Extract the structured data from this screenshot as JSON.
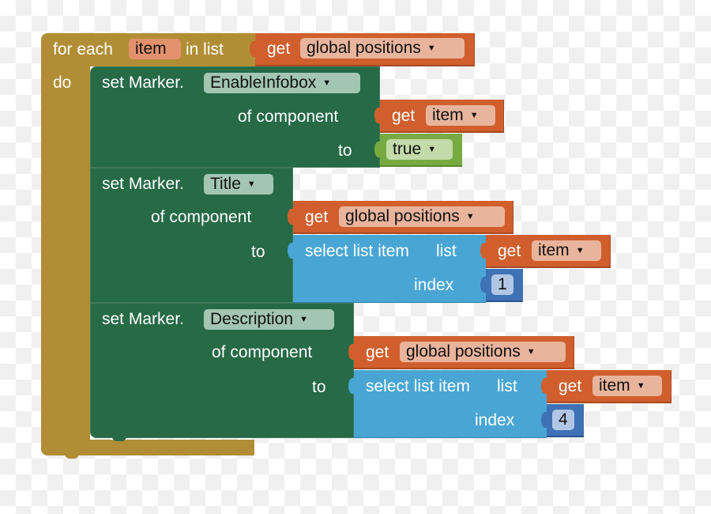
{
  "colors": {
    "control": "#b18e35",
    "component_setter": "#266a46",
    "variable_getter": "#d05f2d",
    "list": "#49a6d4",
    "math_number": "#3f71b5",
    "logic": "#77ab41",
    "checkerboard_light": "#ffffff",
    "checkerboard_dark": "#f0f0f0"
  },
  "for_each": {
    "label_for_each": "for each",
    "loop_var": "item",
    "label_in_list": "in list",
    "label_do": "do",
    "list_getter": {
      "label_get": "get",
      "var": "global positions"
    }
  },
  "setters": [
    {
      "label_set": "set Marker.",
      "property": "EnableInfobox",
      "label_of_component": "of component",
      "label_to": "to",
      "component_getter": {
        "label_get": "get",
        "var": "item"
      },
      "value": {
        "type": "logic",
        "text": "true"
      }
    },
    {
      "label_set": "set Marker.",
      "property": "Title",
      "label_of_component": "of component",
      "label_to": "to",
      "component_getter": {
        "label_get": "get",
        "var": "global positions"
      },
      "value": {
        "type": "select_list_item",
        "label_select": "select list item",
        "label_list": "list",
        "label_index": "index",
        "list_getter": {
          "label_get": "get",
          "var": "item"
        },
        "index": "1"
      }
    },
    {
      "label_set": "set Marker.",
      "property": "Description",
      "label_of_component": "of component",
      "label_to": "to",
      "component_getter": {
        "label_get": "get",
        "var": "global positions"
      },
      "value": {
        "type": "select_list_item",
        "label_select": "select list item",
        "label_list": "list",
        "label_index": "index",
        "list_getter": {
          "label_get": "get",
          "var": "item"
        },
        "index": "4"
      }
    }
  ],
  "icons": {
    "dropdown": "▼"
  }
}
